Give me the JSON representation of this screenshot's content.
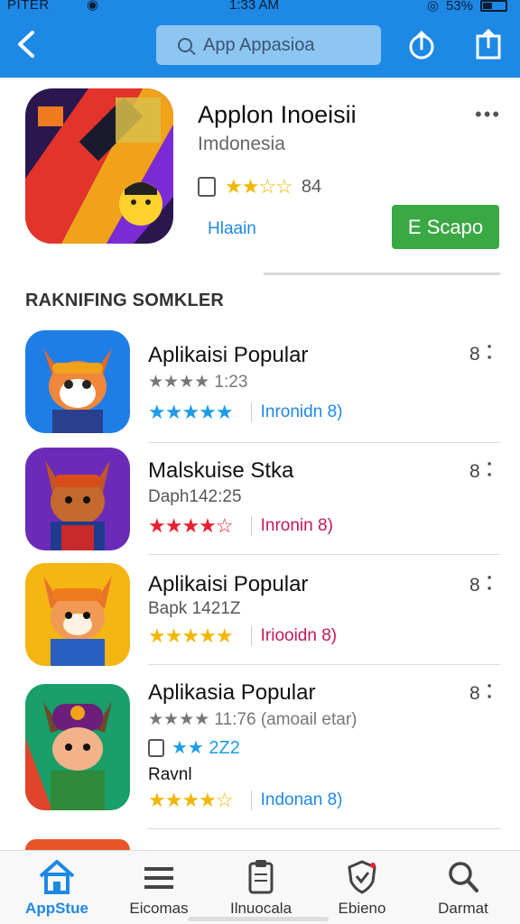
{
  "status": {
    "carrier": "PITER",
    "time": "1:33 AM",
    "battery": "53%"
  },
  "header": {
    "search_placeholder": "App Appasioa",
    "icons": [
      "back-arrow-icon",
      "search-icon",
      "share-icon",
      "upload-icon"
    ]
  },
  "featured": {
    "title": "Applon Inoeisii",
    "subtitle": "Imdonesia",
    "rating_stars": "★★☆☆",
    "rating_text": "84",
    "link_text": "Hlaain",
    "install_label": "E Scapo",
    "more": "•••"
  },
  "section": {
    "title": "RAKNIFING SOMKLER"
  },
  "apps": [
    {
      "title": "Aplikaisi Popular",
      "subtitle": "★★★★ 1:23",
      "stars": "★★★★★",
      "star_color": "#1e9be6",
      "tag": "Inronidn 8)",
      "tag_color": "#1e88e5",
      "count": "8"
    },
    {
      "title": "Malskuise Stka",
      "subtitle": "Daph142:25",
      "stars": "★★★★☆",
      "star_color": "#e8202f",
      "tag": "Inronin 8)",
      "tag_color": "#c2185b",
      "count": "8"
    },
    {
      "title": "Aplikaisi Popular",
      "subtitle": "Bapk 1421Z",
      "stars": "★★★★★",
      "star_color": "#f2b705",
      "tag": "Iriooidn 8)",
      "tag_color": "#c2185b",
      "count": "8"
    },
    {
      "title": "Aplikasia Popular",
      "subtitle": "★★★★ 11:76 (amoail etar)",
      "extra_stars": "★★ 2Z2",
      "extra_label": "Ravnl",
      "stars": "★★★★☆",
      "star_color": "#f2b705",
      "tag": "Indonan 8)",
      "tag_color": "#1e88e5",
      "count": "8"
    }
  ],
  "bottom_nav": [
    {
      "label": "AppStue",
      "icon": "home-icon",
      "active": true
    },
    {
      "label": "Eicomas",
      "icon": "list-icon",
      "active": false
    },
    {
      "label": "Ilnuocala",
      "icon": "clipboard-icon",
      "active": false
    },
    {
      "label": "Ebieno",
      "icon": "shield-icon",
      "active": false
    },
    {
      "label": "Darmat",
      "icon": "search-icon",
      "active": false
    }
  ]
}
